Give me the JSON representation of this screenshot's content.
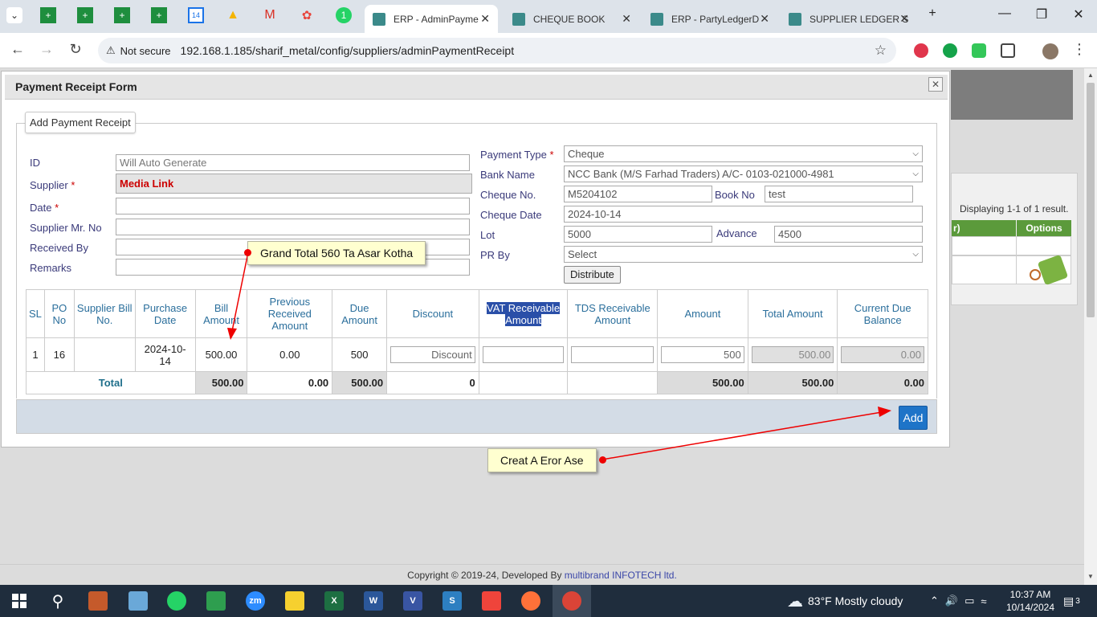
{
  "browser": {
    "tabs": [
      {
        "title": "ERP - AdminPayme",
        "active": true
      },
      {
        "title": "CHEQUE BOOK",
        "active": false
      },
      {
        "title": "ERP - PartyLedgerD",
        "active": false
      },
      {
        "title": "SUPPLIER LEDGER S",
        "active": false
      }
    ],
    "security_label": "Not secure",
    "url": "192.168.1.185/sharif_metal/config/suppliers/adminPaymentReceipt"
  },
  "modal": {
    "title": "Payment Receipt Form",
    "legend": "Add Payment Receipt",
    "left_form": {
      "id_label": "ID",
      "id_placeholder": "Will Auto Generate",
      "supplier_label": "Supplier",
      "supplier_value": "Media Link",
      "date_label": "Date",
      "supplier_mr_label": "Supplier Mr. No",
      "received_by_label": "Received By",
      "remarks_label": "Remarks",
      "required_mark": "*"
    },
    "right_form": {
      "payment_type_label": "Payment Type",
      "payment_type_value": "Cheque",
      "bank_name_label": "Bank Name",
      "bank_name_value": "NCC Bank (M/S Farhad Traders) A/C- 0103-021000-4981",
      "cheque_no_label": "Cheque No.",
      "cheque_no_value": "M5204102",
      "book_no_label": "Book No",
      "book_no_value": "test",
      "cheque_date_label": "Cheque Date",
      "cheque_date_value": "2024-10-14",
      "lot_label": "Lot",
      "lot_value": "5000",
      "advance_label": "Advance",
      "advance_value": "4500",
      "pr_by_label": "PR By",
      "pr_by_value": "Select",
      "distribute_label": "Distribute"
    },
    "table": {
      "headers": {
        "sl": "SL",
        "po_no": "PO No",
        "supplier_bill": "Supplier Bill No.",
        "purchase_date": "Purchase Date",
        "bill_amount": "Bill Amount",
        "prev_received": "Previous Received Amount",
        "due_amount": "Due Amount",
        "discount": "Discount",
        "vat": "VAT Receivable Amount",
        "tds": "TDS Receivable Amount",
        "amount": "Amount",
        "total_amount": "Total Amount",
        "current_due": "Current Due Balance"
      },
      "rows": [
        {
          "sl": "1",
          "po_no": "16",
          "supplier_bill": "",
          "purchase_date": "2024-10-14",
          "bill_amount": "500.00",
          "prev_received": "0.00",
          "due_amount": "500",
          "discount_placeholder": "Discount",
          "vat": "",
          "tds": "",
          "amount": "500",
          "total_amount": "500.00",
          "current_due": "0.00"
        }
      ],
      "total": {
        "label": "Total",
        "bill_amount": "500.00",
        "prev_received": "0.00",
        "due_amount": "500.00",
        "discount": "0",
        "amount": "500.00",
        "total_amount": "500.00",
        "current_due": "0.00"
      }
    },
    "add_label": "Add"
  },
  "annotations": {
    "callout1": "Grand Total 560 Ta Asar Kotha",
    "callout2": "Creat A Eror Ase"
  },
  "background": {
    "displaying": "Displaying 1-1 of 1 result.",
    "options_header": "Options",
    "partial_header": "r)"
  },
  "footer": {
    "prefix": "Copyright © 2019-24, Developed By ",
    "link": "multibrand INFOTECH ltd."
  },
  "taskbar": {
    "weather": "83°F  Mostly cloudy",
    "time": "10:37 AM",
    "date": "10/14/2024",
    "notif_count": "3"
  },
  "colors": {
    "accent_blue": "#1e74c8",
    "label_blue": "#2b6f9c",
    "required_red": "#cc0000",
    "table_header_green": "#5b9a3b"
  }
}
